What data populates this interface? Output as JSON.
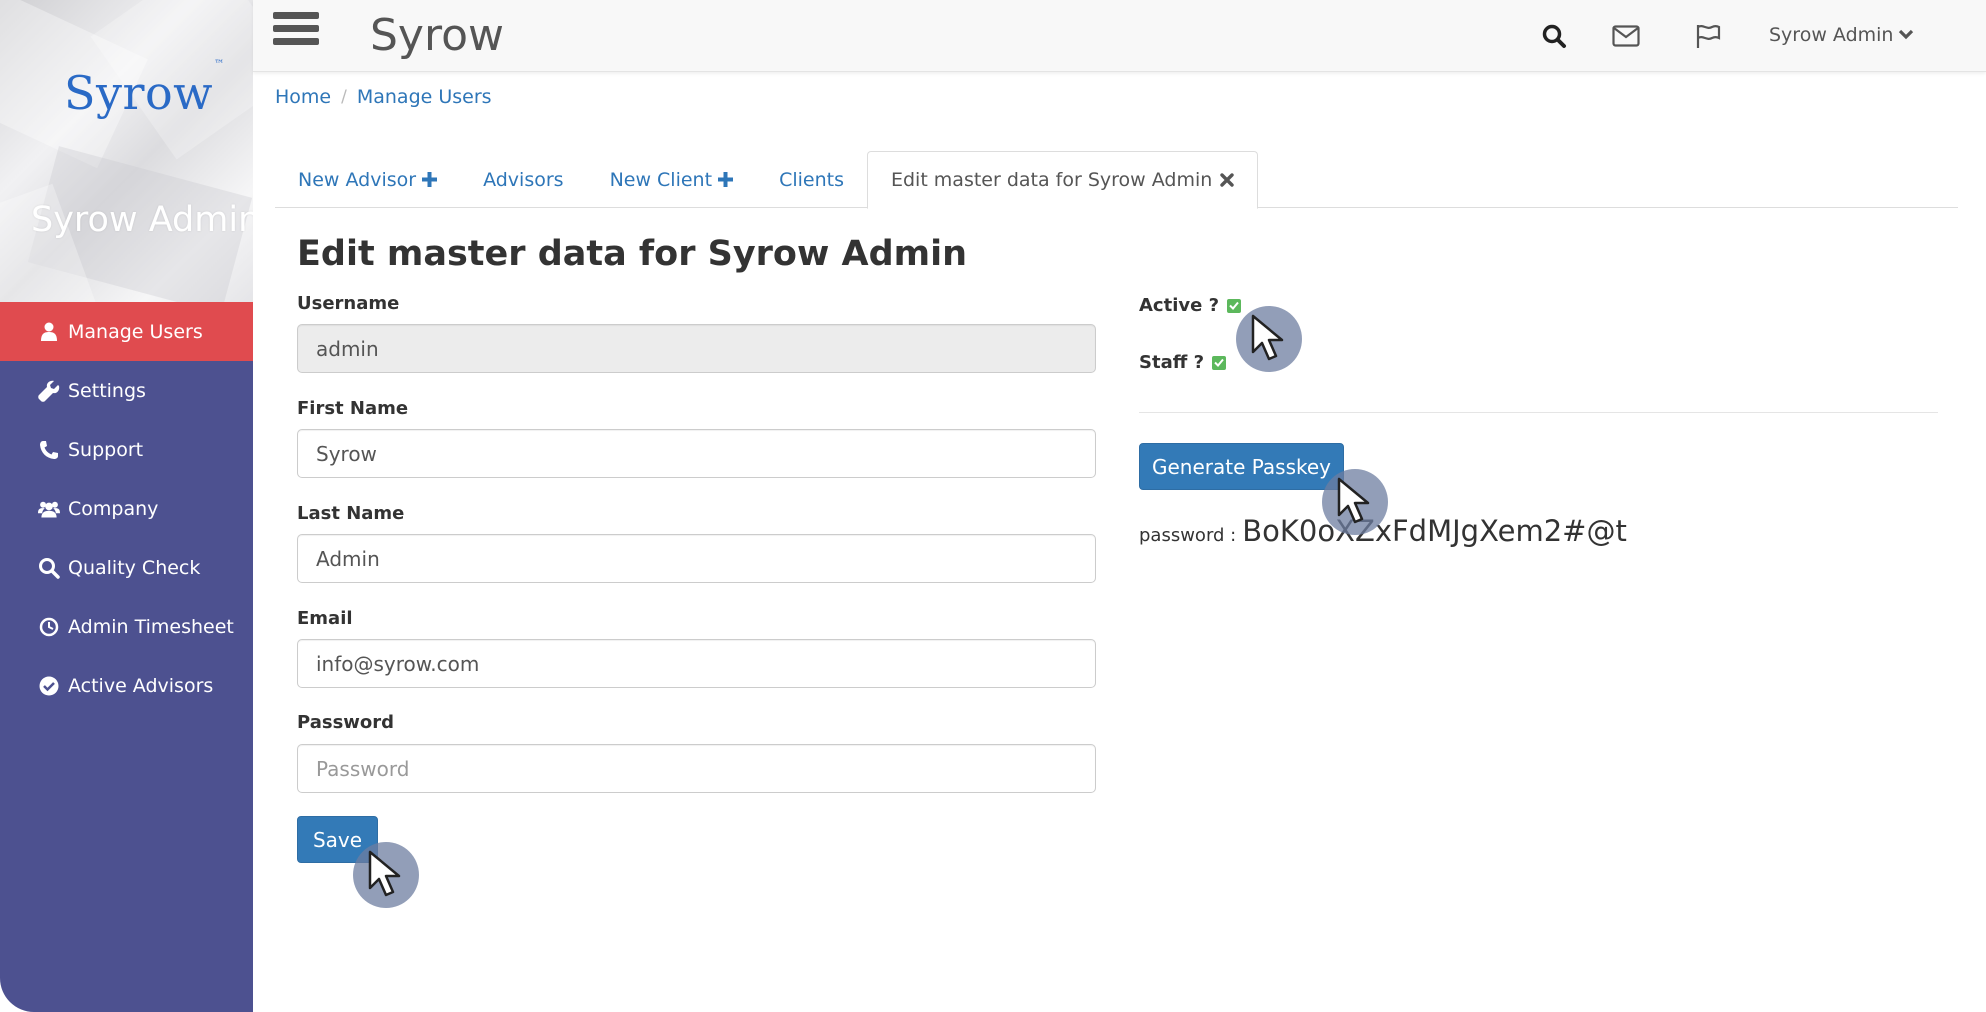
{
  "app": {
    "title": "Syrow",
    "logo_text": "Syrow",
    "logo_mark": "™"
  },
  "sidebar": {
    "user_name": "Syrow Admin",
    "items": [
      {
        "label": "Manage Users",
        "icon": "user-icon",
        "active": true
      },
      {
        "label": "Settings",
        "icon": "wrench-icon",
        "active": false
      },
      {
        "label": "Support",
        "icon": "phone-icon",
        "active": false
      },
      {
        "label": "Company",
        "icon": "users-icon",
        "active": false
      },
      {
        "label": "Quality Check",
        "icon": "search-icon",
        "active": false
      },
      {
        "label": "Admin Timesheet",
        "icon": "clock-icon",
        "active": false
      },
      {
        "label": "Active Advisors",
        "icon": "check-circle-icon",
        "active": false
      }
    ]
  },
  "topbar": {
    "user_menu_label": "Syrow Admin",
    "icons": [
      "search-icon",
      "envelope-icon",
      "flag-icon",
      "chevron-down-icon"
    ]
  },
  "breadcrumb": {
    "home": "Home",
    "current": "Manage Users",
    "separator": "/"
  },
  "tabs": [
    {
      "label": "New Advisor",
      "icon": "plus-icon"
    },
    {
      "label": "Advisors"
    },
    {
      "label": "New Client",
      "icon": "plus-icon"
    },
    {
      "label": "Clients"
    },
    {
      "label": "Edit master data for Syrow Admin",
      "icon": "close-icon",
      "active": true
    }
  ],
  "form": {
    "title": "Edit master data for Syrow Admin",
    "username": {
      "label": "Username",
      "value": "admin"
    },
    "first_name": {
      "label": "First Name",
      "value": "Syrow"
    },
    "last_name": {
      "label": "Last Name",
      "value": "Admin"
    },
    "email": {
      "label": "Email",
      "value": "info@syrow.com"
    },
    "password": {
      "label": "Password",
      "placeholder": "Password"
    },
    "save_label": "Save"
  },
  "status": {
    "active_label": "Active ?",
    "active_checked": true,
    "staff_label": "Staff ?",
    "staff_checked": true
  },
  "passkey": {
    "button_label": "Generate Passkey",
    "password_label": "password :",
    "password_value": "BoK0oXZxFdMJgXem2#@t"
  },
  "colors": {
    "sidebar_bg": "#4d5190",
    "active_nav_bg": "#e04b4f",
    "link": "#2e76b8",
    "primary_button": "#337ab7",
    "checkbox": "#5cb85c"
  }
}
